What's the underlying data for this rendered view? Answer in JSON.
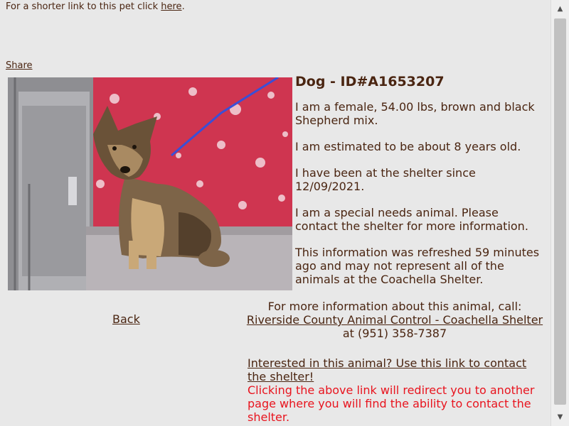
{
  "header": {
    "short_link_text": "For a shorter link to this pet click",
    "short_link_label": "here",
    "short_link_suffix": "."
  },
  "share_label": "Share",
  "pet": {
    "title": "Dog - ID#A1653207",
    "description": "I am a female, 54.00 lbs, brown and black Shepherd mix.",
    "age": "I am estimated to be about 8 years old.",
    "since": "I have been at the shelter since 12/09/2021.",
    "special_needs": "I am a special needs animal. Please contact the shelter for more information.",
    "refresh_note": "This information was refreshed 59 minutes ago and may not represent all of the animals at the Coachella Shelter."
  },
  "back_label": "Back",
  "contact": {
    "intro": "For more information about this animal, call:",
    "shelter_name": "Riverside County Animal Control - Coachella Shelter",
    "phone_text": " at (951) 358-7387"
  },
  "interest": {
    "link_label": "Interested in this animal? Use this link to contact the shelter!",
    "warning": "Clicking the above link will redirect you to another page where you will find the ability to contact the shelter."
  },
  "scrollbar": {
    "up_icon": "triangle-up",
    "down_icon": "triangle-down"
  },
  "colors": {
    "background": "#e8e8e8",
    "text": "#4a2511",
    "warning": "#e8141e"
  }
}
